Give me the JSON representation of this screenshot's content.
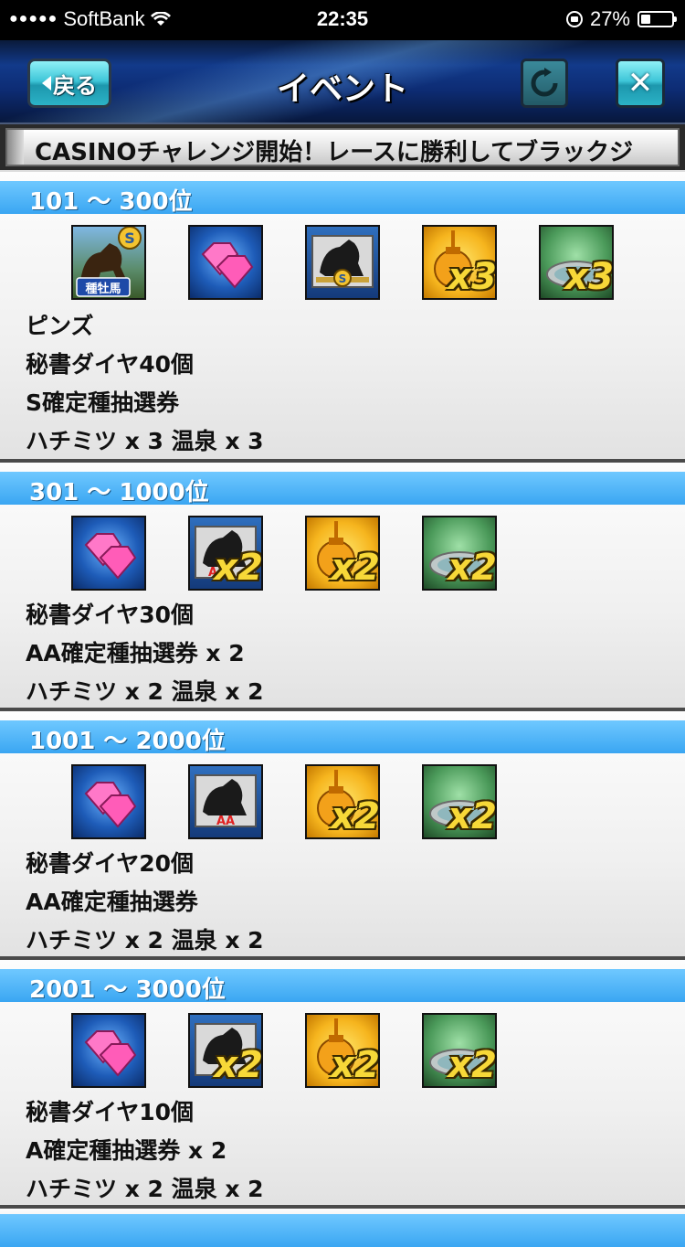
{
  "status_bar": {
    "carrier": "SoftBank",
    "time": "22:35",
    "battery": "27%"
  },
  "header": {
    "back_label": "戻る",
    "title": "イベント",
    "close_label": "✕"
  },
  "ticker": {
    "text": "CASINOチャレンジ開始！レースに勝利してブラックジ"
  },
  "tiers": [
    {
      "range": "101 〜 300位",
      "icons": [
        {
          "name": "stallion-pins-icon",
          "label": "種牡馬",
          "badge": "S"
        },
        {
          "name": "diamond-icon"
        },
        {
          "name": "s-ticket-icon",
          "badge": "S"
        },
        {
          "name": "honey-icon",
          "mult": "x3"
        },
        {
          "name": "onsen-icon",
          "mult": "x3"
        }
      ],
      "items": [
        "ピンズ",
        "秘書ダイヤ40個",
        "S確定種抽選券",
        "ハチミツ x 3 温泉 x 3"
      ]
    },
    {
      "range": "301 〜 1000位",
      "icons": [
        {
          "name": "diamond-icon"
        },
        {
          "name": "aa-ticket-icon",
          "badge": "AA",
          "mult": "x2"
        },
        {
          "name": "honey-icon",
          "mult": "x2"
        },
        {
          "name": "onsen-icon",
          "mult": "x2"
        }
      ],
      "items": [
        "秘書ダイヤ30個",
        "AA確定種抽選券 x 2",
        "ハチミツ x 2 温泉 x 2"
      ]
    },
    {
      "range": "1001 〜 2000位",
      "icons": [
        {
          "name": "diamond-icon"
        },
        {
          "name": "aa-ticket-icon",
          "badge": "AA"
        },
        {
          "name": "honey-icon",
          "mult": "x2"
        },
        {
          "name": "onsen-icon",
          "mult": "x2"
        }
      ],
      "items": [
        "秘書ダイヤ20個",
        "AA確定種抽選券",
        "ハチミツ x 2 温泉 x 2"
      ]
    },
    {
      "range": "2001 〜 3000位",
      "icons": [
        {
          "name": "diamond-icon"
        },
        {
          "name": "a-ticket-icon",
          "badge": "A",
          "mult": "x2"
        },
        {
          "name": "honey-icon",
          "mult": "x2"
        },
        {
          "name": "onsen-icon",
          "mult": "x2"
        }
      ],
      "items": [
        "秘書ダイヤ10個",
        "A確定種抽選券 x 2",
        "ハチミツ x 2 温泉 x 2"
      ]
    }
  ]
}
